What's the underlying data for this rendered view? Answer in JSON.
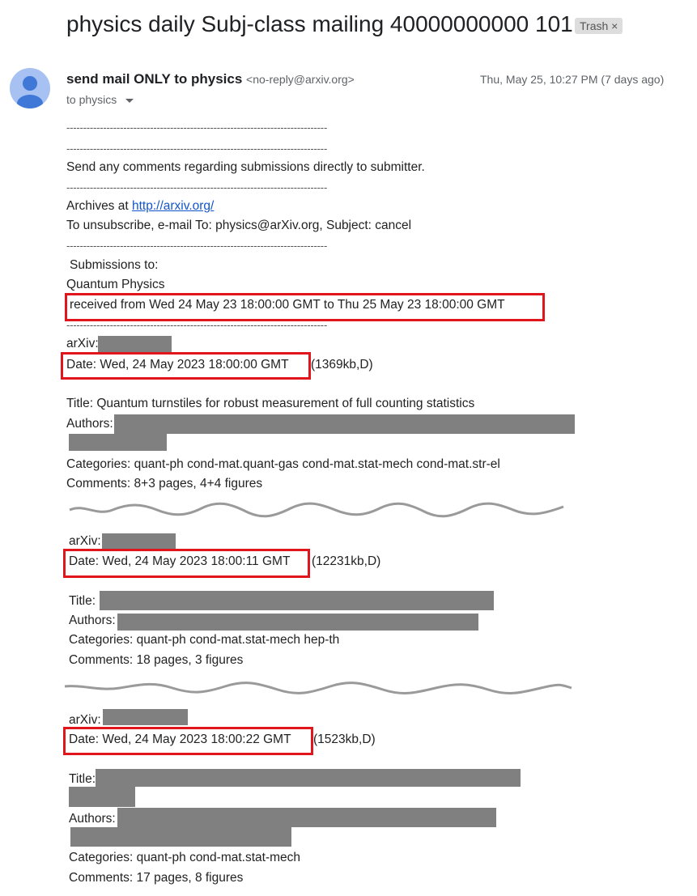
{
  "header": {
    "subject": "physics daily Subj-class mailing 40000000000 101",
    "label": "Trash",
    "label_close": "×"
  },
  "message": {
    "sender_name": "send mail ONLY to physics",
    "sender_email": "<no-reply@arxiv.org>",
    "date": "Thu, May 25, 10:27 PM (7 days ago)",
    "to": "to physics",
    "dashes": "------------------------------------------------------------------------------",
    "comments_line": "Send any comments regarding submissions directly to submitter.",
    "archives_label": "Archives at ",
    "archives_link": "http://arxiv.org/",
    "unsubscribe": "To unsubscribe, e-mail To: physics@arXiv.org, Subject: cancel",
    "submissions_to": "Submissions to:",
    "category": "Quantum Physics",
    "received_from": "received from  Wed 24 May 23 18:00:00 GMT  to  Thu 25 May 23 18:00:00 GMT"
  },
  "entries": [
    {
      "arxiv": "arXiv:",
      "date": "Date: Wed, 24 May 2023 18:00:00 GMT",
      "size": "(1369kb,D)",
      "title": "Title: Quantum turnstiles for robust measurement of full counting statistics",
      "authors": "Authors:",
      "categories": "Categories: quant-ph cond-mat.quant-gas cond-mat.stat-mech cond-mat.str-el",
      "comments": "Comments: 8+3 pages, 4+4 figures"
    },
    {
      "arxiv": "arXiv:",
      "date": "Date: Wed, 24 May 2023 18:00:11 GMT",
      "size": "(12231kb,D)",
      "title": "Title:",
      "authors": "Authors:",
      "categories": "Categories: quant-ph cond-mat.stat-mech hep-th",
      "comments": "Comments: 18 pages, 3 figures"
    },
    {
      "arxiv": "arXiv:",
      "date": "Date: Wed, 24 May 2023 18:00:22 GMT",
      "size": "(1523kb,D)",
      "title": "Title:",
      "authors": "Authors:",
      "categories": "Categories: quant-ph cond-mat.stat-mech",
      "comments": "Comments: 17 pages, 8 figures"
    }
  ],
  "colors": {
    "highlight": "#e0161c",
    "redaction": "#808080",
    "link": "#1155cc"
  }
}
